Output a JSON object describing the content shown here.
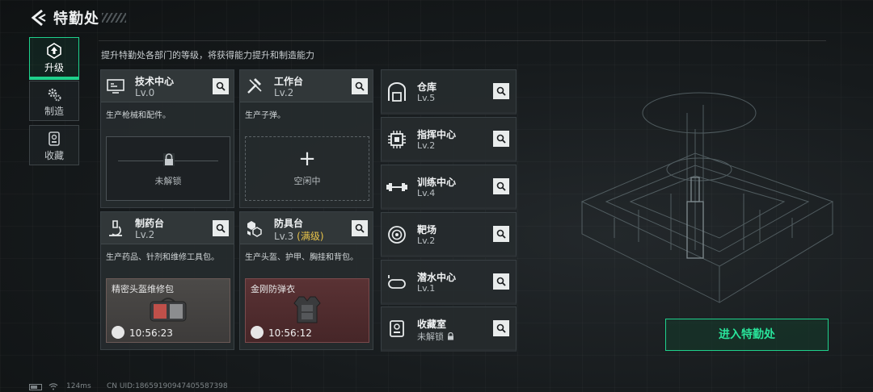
{
  "header": {
    "title": "特勤处"
  },
  "subtitle": "提升特勤处各部门的等级，将获得能力提升和制造能力",
  "tabs": [
    {
      "label": "升级",
      "icon": "upgrade-icon",
      "active": true
    },
    {
      "label": "制造",
      "icon": "gears-icon",
      "active": false
    },
    {
      "label": "收藏",
      "icon": "collection-icon",
      "active": false
    }
  ],
  "cards": {
    "tech": {
      "name": "技术中心",
      "level": "Lv.0",
      "desc": "生产枪械和配件。",
      "slot_text": "未解锁"
    },
    "workbench": {
      "name": "工作台",
      "level": "Lv.2",
      "desc": "生产子弹。",
      "slot_plus": "+",
      "slot_text": "空闲中"
    },
    "pharmacy": {
      "name": "制药台",
      "level": "Lv.2",
      "desc": "生产药品、针剂和维修工具包。",
      "craft_name": "精密头盔维修包",
      "craft_time": "10:56:23"
    },
    "armory": {
      "name": "防具台",
      "level": "Lv.3",
      "level_max": "(满级)",
      "desc": "生产头盔、护甲、胸挂和背包。",
      "craft_name": "金刚防弹衣",
      "craft_time": "10:56:12"
    }
  },
  "small_cards": [
    {
      "name": "仓库",
      "level": "Lv.5"
    },
    {
      "name": "指挥中心",
      "level": "Lv.2"
    },
    {
      "name": "训练中心",
      "level": "Lv.4"
    },
    {
      "name": "靶场",
      "level": "Lv.2"
    },
    {
      "name": "潜水中心",
      "level": "Lv.1"
    },
    {
      "name": "收藏室",
      "level": "未解锁"
    }
  ],
  "enter_button": "进入特勤处",
  "footer": {
    "ping": "124ms",
    "uid": "CN UID:186591909474055873​98"
  },
  "colors": {
    "accent": "#1fd18c",
    "max_level": "#e8c34a",
    "card_bg": "#262b2e"
  }
}
